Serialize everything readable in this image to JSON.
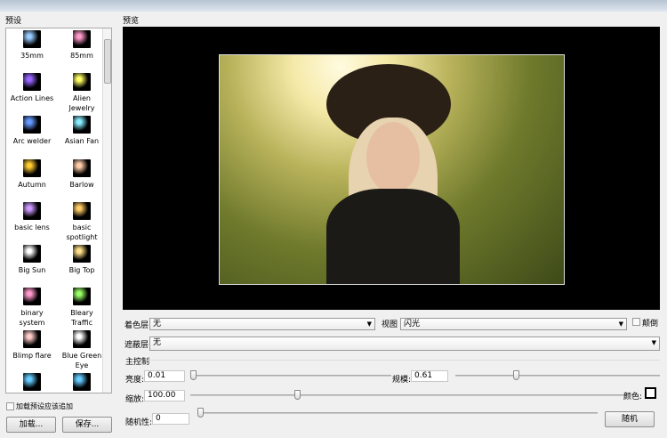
{
  "presets": {
    "title": "预设",
    "items": [
      "35mm",
      "85mm",
      "Action Lines",
      "Alien Jewelry",
      "Arc welder",
      "Asian Fan",
      "Autumn",
      "Barlow",
      "basic lens",
      "basic spotlight",
      "Big Sun",
      "Big Top",
      "binary system",
      "Bleary Traffic",
      "Blimp flare",
      "Blue Green Eye",
      "",
      ""
    ],
    "append_label": "加载预设应该追加",
    "append_checked": false,
    "load_label": "加载...",
    "save_label": "保存..."
  },
  "preview": {
    "title": "预览"
  },
  "options": {
    "color_layer_label": "着色层",
    "color_layer_value": "无",
    "view_label": "视图",
    "view_value": "闪光",
    "invert_label": "颠倒",
    "invert_checked": false,
    "mask_label": "遮蔽层",
    "mask_value": "无"
  },
  "master": {
    "title": "主控制",
    "brightness_label": "亮度:",
    "brightness": "0.01",
    "scale_label": "规模:",
    "scale": "0.61",
    "zoom_label": "缩放:",
    "zoom": "100.00",
    "color_label": "颜色:",
    "color": "#ffffff",
    "random_label": "随机性:",
    "random": "0",
    "random_button": "随机"
  }
}
